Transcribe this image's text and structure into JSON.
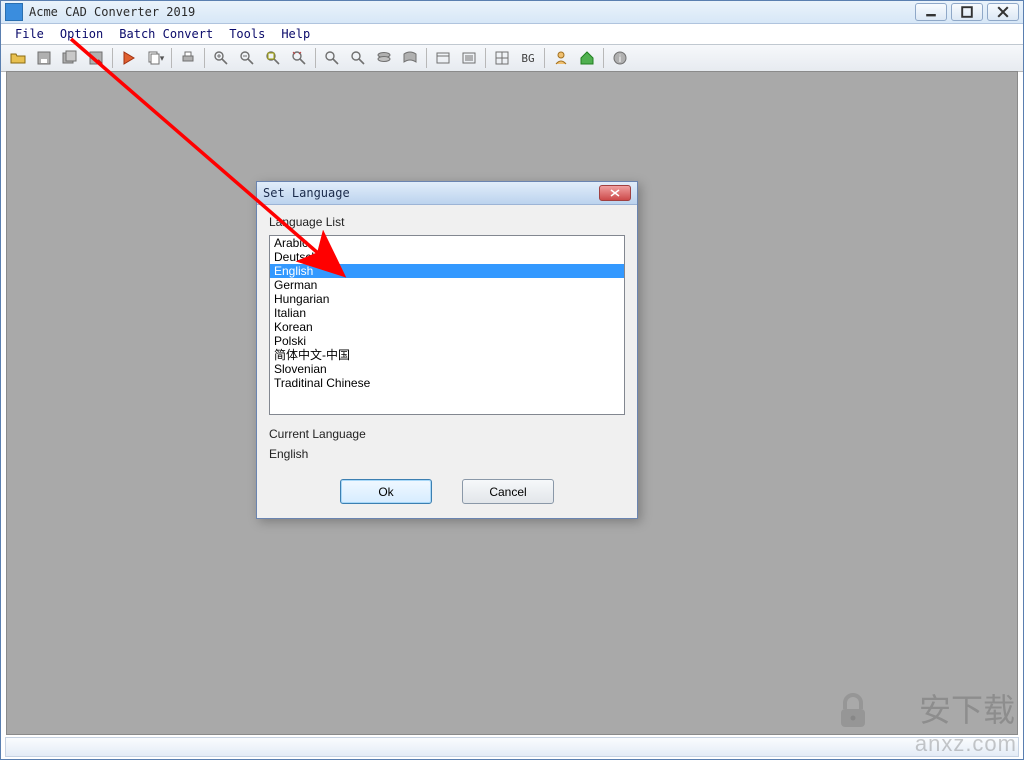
{
  "app": {
    "title": "Acme CAD Converter 2019"
  },
  "menu": {
    "file": "File",
    "option": "Option",
    "batch": "Batch Convert",
    "tools": "Tools",
    "help": "Help"
  },
  "toolbar_icons": [
    "open",
    "save",
    "saveall",
    "saveas",
    "exec",
    "copy",
    "print",
    "zoomin",
    "zoomout",
    "zoomwin",
    "zoomext",
    "zoomprev",
    "pan",
    "layer",
    "view",
    "layout",
    "list",
    "grid",
    "bg",
    "user",
    "home",
    "info"
  ],
  "dialog": {
    "title": "Set Language",
    "list_label": "Language List",
    "languages": [
      "Arabic",
      "Deutsch",
      "English",
      "German",
      "Hungarian",
      "Italian",
      "Korean",
      "Polski",
      "简体中文-中国",
      "Slovenian",
      "Traditinal Chinese"
    ],
    "selected_index": 2,
    "current_label": "Current Language",
    "current_value": "English",
    "ok": "Ok",
    "cancel": "Cancel"
  },
  "toolbar_bg_label": "BG",
  "watermark": {
    "url": "anxz.com",
    "side": "安下载"
  }
}
